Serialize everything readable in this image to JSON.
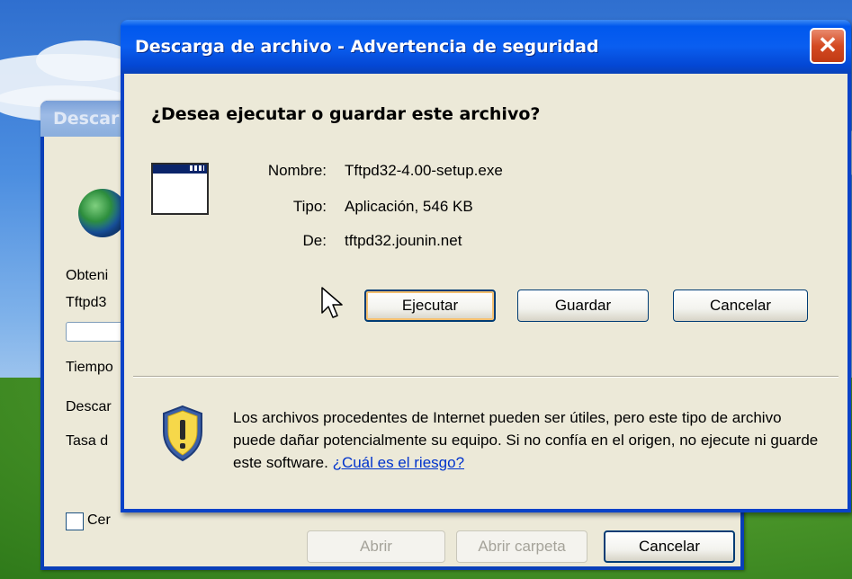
{
  "dialog": {
    "title": "Descarga de archivo - Advertencia de seguridad",
    "close_label": "✕",
    "question": "¿Desea ejecutar o guardar este archivo?",
    "file": {
      "name_label": "Nombre:",
      "name_value": "Tftpd32-4.00-setup.exe",
      "type_label": "Tipo:",
      "type_value": "Aplicación, 546 KB",
      "from_label": "De:",
      "from_value": "tftpd32.jounin.net"
    },
    "buttons": {
      "run": "Ejecutar",
      "save": "Guardar",
      "cancel": "Cancelar"
    },
    "warning_text": "Los archivos procedentes de Internet pueden ser útiles, pero este tipo de archivo puede dañar potencialmente su equipo. Si no confía en el origen, no ejecute ni guarde este software.",
    "warning_link": "¿Cuál es el riesgo?"
  },
  "background_dialog": {
    "title": "Descar",
    "obtaining": "Obteni",
    "filename": "Tftpd3",
    "time": "Tiempo",
    "download_to": "Descar",
    "rate": "Tasa d",
    "close_checkbox": "Cer",
    "buttons": {
      "open": "Abrir",
      "open_folder": "Abrir carpeta",
      "cancel": "Cancelar"
    }
  },
  "colors": {
    "titlebar": "#0058ee",
    "dialog_face": "#ece9d8",
    "link": "#0033cc",
    "close_button": "#d44a22"
  }
}
